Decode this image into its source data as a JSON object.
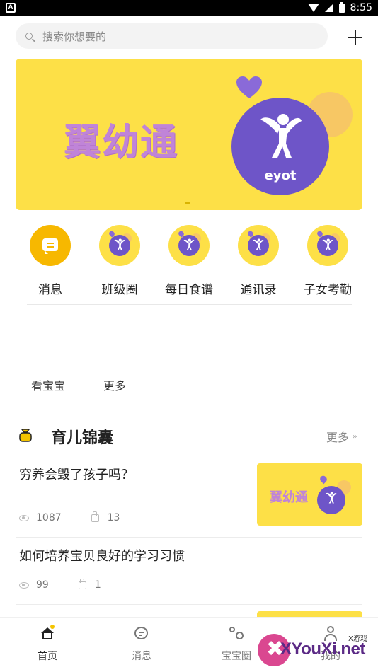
{
  "status_bar": {
    "time": "8:55"
  },
  "search": {
    "placeholder": "搜索你想要的"
  },
  "banner": {
    "brand": "翼幼通",
    "logo_text": "eyot"
  },
  "quick_menu": [
    {
      "label": "消息",
      "icon": "message-icon"
    },
    {
      "label": "班级圈",
      "icon": "eyot-logo-icon"
    },
    {
      "label": "每日食谱",
      "icon": "eyot-logo-icon"
    },
    {
      "label": "通讯录",
      "icon": "eyot-logo-icon"
    },
    {
      "label": "子女考勤",
      "icon": "eyot-logo-icon"
    }
  ],
  "kids_row": {
    "view_baby": "看宝宝",
    "more": "更多"
  },
  "section": {
    "title": "育儿锦囊",
    "more": "更多"
  },
  "articles": [
    {
      "title": "穷养会毁了孩子吗？",
      "views": "1087",
      "likes": "13",
      "thumb_text": "翼幼通",
      "thumb_logo": "eyot"
    },
    {
      "title": "如何培养宝贝良好的学习习惯",
      "views": "99",
      "likes": "1"
    }
  ],
  "bottom_nav": [
    {
      "label": "首页",
      "icon": "home-icon"
    },
    {
      "label": "消息",
      "icon": "chat-icon"
    },
    {
      "label": "宝宝圈",
      "icon": "circles-icon"
    },
    {
      "label": "我的",
      "icon": "person-icon"
    }
  ],
  "watermark": {
    "text": "XYouXi.net",
    "small": "X游戏"
  },
  "colors": {
    "accent": "#fde047",
    "brand_purple": "#6e55c8",
    "text": "#222222"
  }
}
